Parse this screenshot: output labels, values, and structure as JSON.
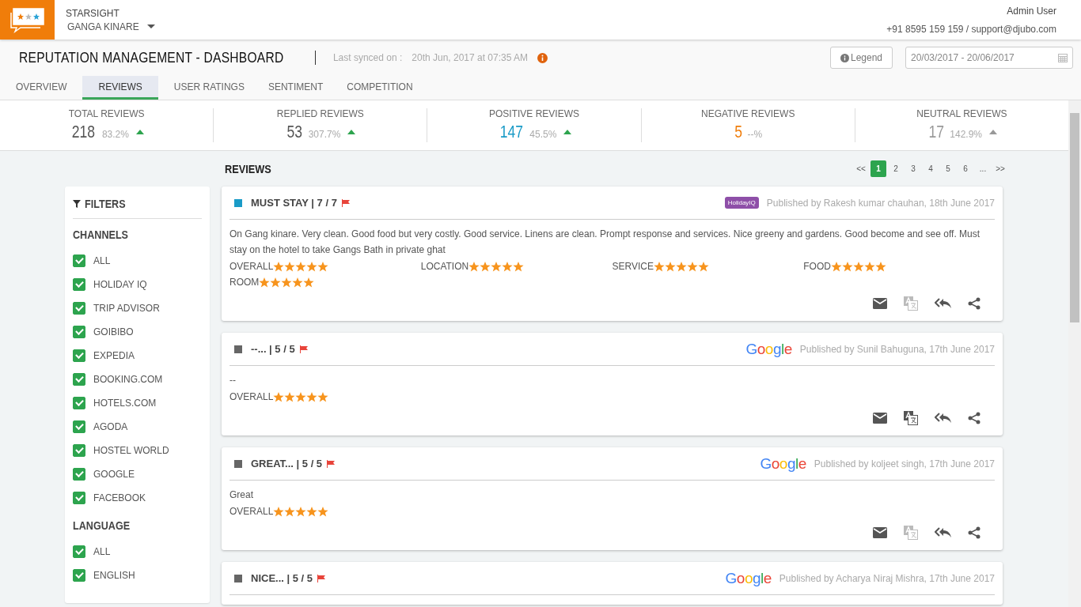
{
  "header": {
    "brand": "STARSIGHT",
    "property": "GANGA KINARE",
    "user": "Admin User",
    "contact": "+91 8595 159 159 / support@djubo.com"
  },
  "title_bar": {
    "title": "REPUTATION MANAGEMENT - DASHBOARD",
    "sync_label": "Last synced on :",
    "sync_time": "20th Jun, 2017 at 07:35 AM",
    "legend_button": "Legend",
    "date_range": "20/03/2017 - 20/06/2017"
  },
  "tabs": [
    {
      "label": "OVERVIEW",
      "selected": false
    },
    {
      "label": "REVIEWS",
      "selected": true
    },
    {
      "label": "USER RATINGS",
      "selected": false
    },
    {
      "label": "SENTIMENT",
      "selected": false
    },
    {
      "label": "COMPETITION",
      "selected": false
    }
  ],
  "stats": [
    {
      "label": "TOTAL REVIEWS",
      "value": "218",
      "change": "83.2%",
      "arrow": true,
      "arrow_positive": true,
      "color": "#555555"
    },
    {
      "label": "REPLIED REVIEWS",
      "value": "53",
      "change": "307.7%",
      "arrow": true,
      "arrow_positive": true,
      "color": "#555555"
    },
    {
      "label": "POSITIVE REVIEWS",
      "value": "147",
      "change": "45.5%",
      "arrow": true,
      "arrow_positive": true,
      "color": "#1a9bc7"
    },
    {
      "label": "NEGATIVE REVIEWS",
      "value": "5",
      "change": "--%",
      "arrow": false,
      "color": "#f07d0a"
    },
    {
      "label": "NEUTRAL REVIEWS",
      "value": "17",
      "change": "142.9%",
      "arrow": true,
      "arrow_positive": false,
      "color": "#999999"
    }
  ],
  "reviews_heading": "REVIEWS",
  "pagination": {
    "prev": "<<",
    "next": ">>",
    "pages": [
      {
        "label": "1",
        "selected": true
      },
      {
        "label": "2",
        "selected": false
      },
      {
        "label": "3",
        "selected": false
      },
      {
        "label": "4",
        "selected": false
      },
      {
        "label": "5",
        "selected": false
      },
      {
        "label": "6",
        "selected": false
      },
      {
        "label": "...",
        "selected": false
      }
    ]
  },
  "filters": {
    "title": "FILTERS",
    "groups": [
      {
        "title": "CHANNELS",
        "items": [
          {
            "label": "ALL",
            "checked": true
          },
          {
            "label": "HOLIDAY IQ",
            "checked": true
          },
          {
            "label": "TRIP ADVISOR",
            "checked": true
          },
          {
            "label": "GOIBIBO",
            "checked": true
          },
          {
            "label": "EXPEDIA",
            "checked": true
          },
          {
            "label": "BOOKING.COM",
            "checked": true
          },
          {
            "label": "HOTELS.COM",
            "checked": true
          },
          {
            "label": "AGODA",
            "checked": true
          },
          {
            "label": "HOSTEL WORLD",
            "checked": true
          },
          {
            "label": "GOOGLE",
            "checked": true
          },
          {
            "label": "FACEBOOK",
            "checked": true
          }
        ]
      },
      {
        "title": "LANGUAGE",
        "items": [
          {
            "label": "ALL",
            "checked": true
          },
          {
            "label": "ENGLISH",
            "checked": true
          }
        ]
      }
    ]
  },
  "reviews": [
    {
      "title": "MUST STAY | 7 / 7",
      "color": "#1a9bc7",
      "source": {
        "kind": "holidayiq",
        "name": "HolidayIQ"
      },
      "published": "Published by Rakesh kumar chauhan, 18th June 2017",
      "text": "On Gang kinare. Very clean. Good food but very costly. Good service. Linens are clean. Prompt response and services. Nice greeny and gardens. Good become and see off. Must stay on the hotel to take Gangs Bath in private ghat",
      "ratings": [
        {
          "label": "OVERALL",
          "stars": 5
        },
        {
          "label": "LOCATION",
          "stars": 5
        },
        {
          "label": "SERVICE",
          "stars": 5
        },
        {
          "label": "FOOD",
          "stars": 5
        },
        {
          "label": "ROOM",
          "stars": 5
        }
      ],
      "translate_enabled": false
    },
    {
      "title": "--... | 5 / 5",
      "color": "#666666",
      "source": {
        "kind": "google",
        "name": "Google"
      },
      "published": "Published by Sunil Bahuguna, 17th June 2017",
      "text": "--",
      "ratings": [
        {
          "label": "OVERALL",
          "stars": 5
        }
      ],
      "translate_enabled": true
    },
    {
      "title": "GREAT... | 5 / 5",
      "color": "#666666",
      "source": {
        "kind": "google",
        "name": "Google"
      },
      "published": "Published by koljeet singh, 17th June 2017",
      "text": "Great",
      "ratings": [
        {
          "label": "OVERALL",
          "stars": 5
        }
      ],
      "translate_enabled": false
    },
    {
      "title": "NICE... | 5 / 5",
      "color": "#666666",
      "source": {
        "kind": "google",
        "name": "Google"
      },
      "published": "Published by Acharya Niraj Mishra, 17th June 2017"
    }
  ]
}
